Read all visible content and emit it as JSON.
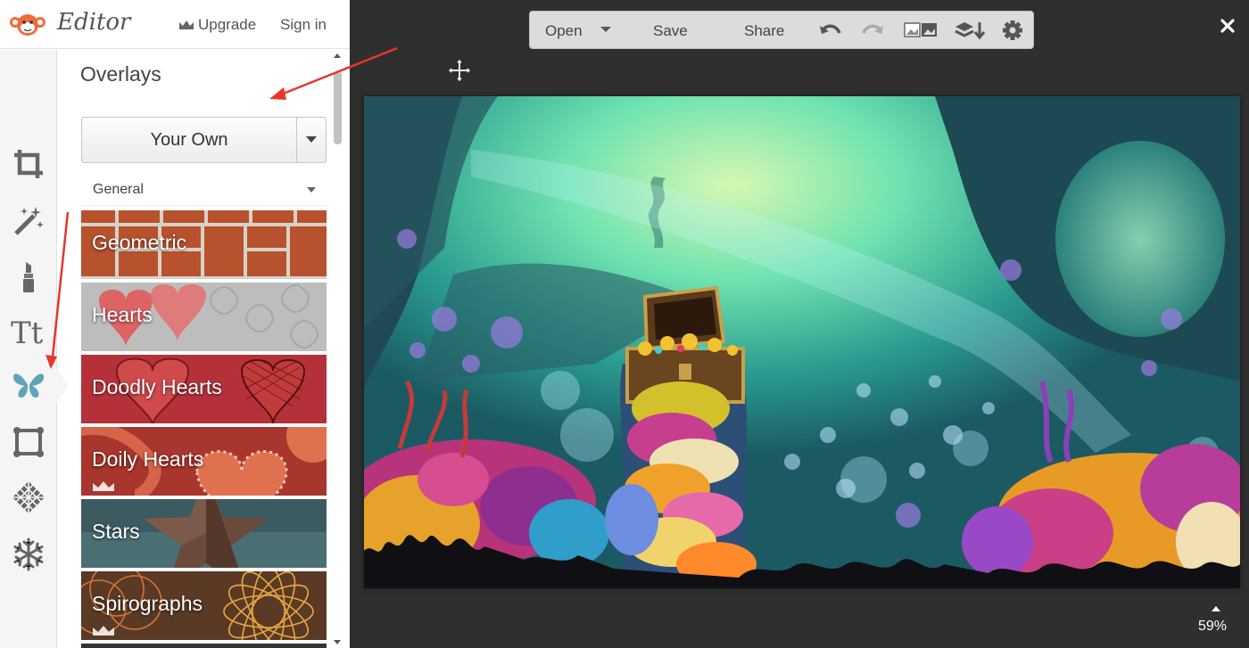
{
  "header": {
    "app_title": "Editor",
    "upgrade_label": "Upgrade",
    "signin_label": "Sign in"
  },
  "tools": [
    {
      "icon": "crop-icon"
    },
    {
      "icon": "magic-wand-icon"
    },
    {
      "icon": "lipstick-icon"
    },
    {
      "icon": "text-icon",
      "glyph": "Tt"
    },
    {
      "icon": "butterfly-icon",
      "active": true
    },
    {
      "icon": "frame-icon"
    },
    {
      "icon": "texture-icon"
    },
    {
      "icon": "snowflake-icon"
    }
  ],
  "panel": {
    "title": "Overlays",
    "your_own_label": "Your Own",
    "category_selected": "General",
    "items": [
      {
        "label": "Geometric",
        "premium": false
      },
      {
        "label": "Hearts",
        "premium": false
      },
      {
        "label": "Doodly Hearts",
        "premium": false
      },
      {
        "label": "Doily Hearts",
        "premium": true
      },
      {
        "label": "Stars",
        "premium": false
      },
      {
        "label": "Spirographs",
        "premium": true
      }
    ]
  },
  "toolbar": {
    "open_label": "Open",
    "save_label": "Save",
    "share_label": "Share"
  },
  "canvas": {
    "zoom": "59%"
  },
  "colors": {
    "accent": "#ef6c3a",
    "active_tool": "#5da4b8",
    "annotation_arrow": "#e8352b",
    "workspace_bg": "#2f2f2f"
  }
}
